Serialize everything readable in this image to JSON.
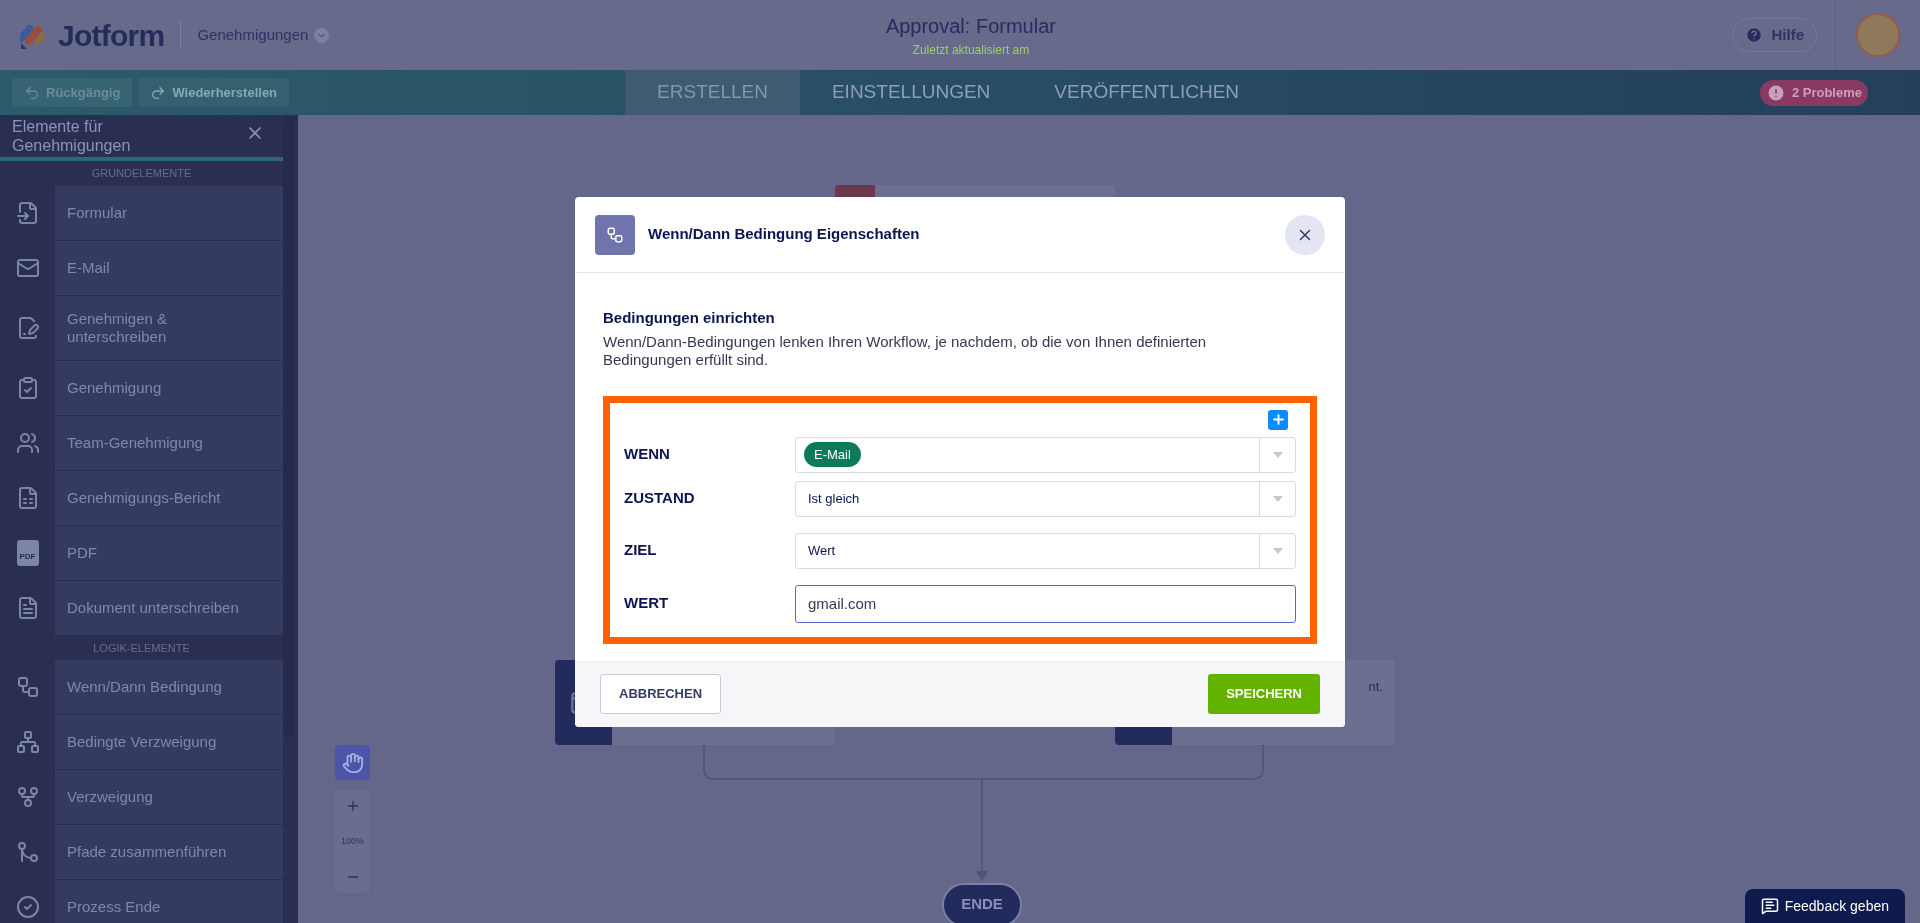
{
  "header": {
    "logo": "Jotform",
    "workspace": "Genehmigungen",
    "title": "Approval: Formular",
    "subtitle": "Zuletzt aktualisiert am",
    "help": "Hilfe"
  },
  "toolbar": {
    "undo": "Rückgängig",
    "redo": "Wiederherstellen",
    "problems": "2 Probleme"
  },
  "tabs": [
    {
      "label": "ERSTELLEN",
      "selected": true
    },
    {
      "label": "EINSTELLUNGEN",
      "selected": false
    },
    {
      "label": "VERÖFFENTLICHEN",
      "selected": false
    }
  ],
  "sidebar": {
    "title": "Elemente für Genehmigungen",
    "sections": [
      {
        "heading": "GRUNDELEMENTE",
        "items": [
          {
            "label": "Formular",
            "kind": "form"
          },
          {
            "label": "E-Mail",
            "kind": "email"
          },
          {
            "label": "Genehmigen & unterschreiben",
            "kind": "sign"
          },
          {
            "label": "Genehmigung",
            "kind": "approval"
          },
          {
            "label": "Team-Genehmigung",
            "kind": "team"
          },
          {
            "label": "Genehmigungs-Bericht",
            "kind": "report"
          },
          {
            "label": "PDF",
            "kind": "pdf",
            "icon_text": "PDF"
          },
          {
            "label": "Dokument unterschreiben",
            "kind": "document"
          }
        ]
      },
      {
        "heading": "LOGIK-ELEMENTE",
        "items": [
          {
            "label": "Wenn/Dann Bedingung",
            "kind": "condition"
          },
          {
            "label": "Bedingte Verzweigung",
            "kind": "conditional-branch"
          },
          {
            "label": "Verzweigung",
            "kind": "branch"
          },
          {
            "label": "Pfade zusammenführen",
            "kind": "merge"
          },
          {
            "label": "Prozess Ende",
            "kind": "end"
          }
        ]
      }
    ]
  },
  "canvas": {
    "node_text": "nt.",
    "end": "ENDE",
    "zoom": "100%"
  },
  "modal": {
    "title": "Wenn/Dann Bedingung Eigenschaften",
    "section_title": "Bedingungen einrichten",
    "description": "Wenn/Dann-Bedingungen lenken Ihren Workflow, je nachdem, ob die von Ihnen definierten Bedingungen erfüllt sind.",
    "rows": [
      {
        "label": "WENN",
        "kind": "tag",
        "value": "E-Mail"
      },
      {
        "label": "ZUSTAND",
        "kind": "select",
        "value": "Ist gleich"
      },
      {
        "label": "ZIEL",
        "kind": "select",
        "value": "Wert"
      },
      {
        "label": "WERT",
        "kind": "input",
        "value": "gmail.com"
      }
    ],
    "cancel": "ABBRECHEN",
    "save": "SPEICHERN"
  },
  "feedback": "Feedback geben"
}
